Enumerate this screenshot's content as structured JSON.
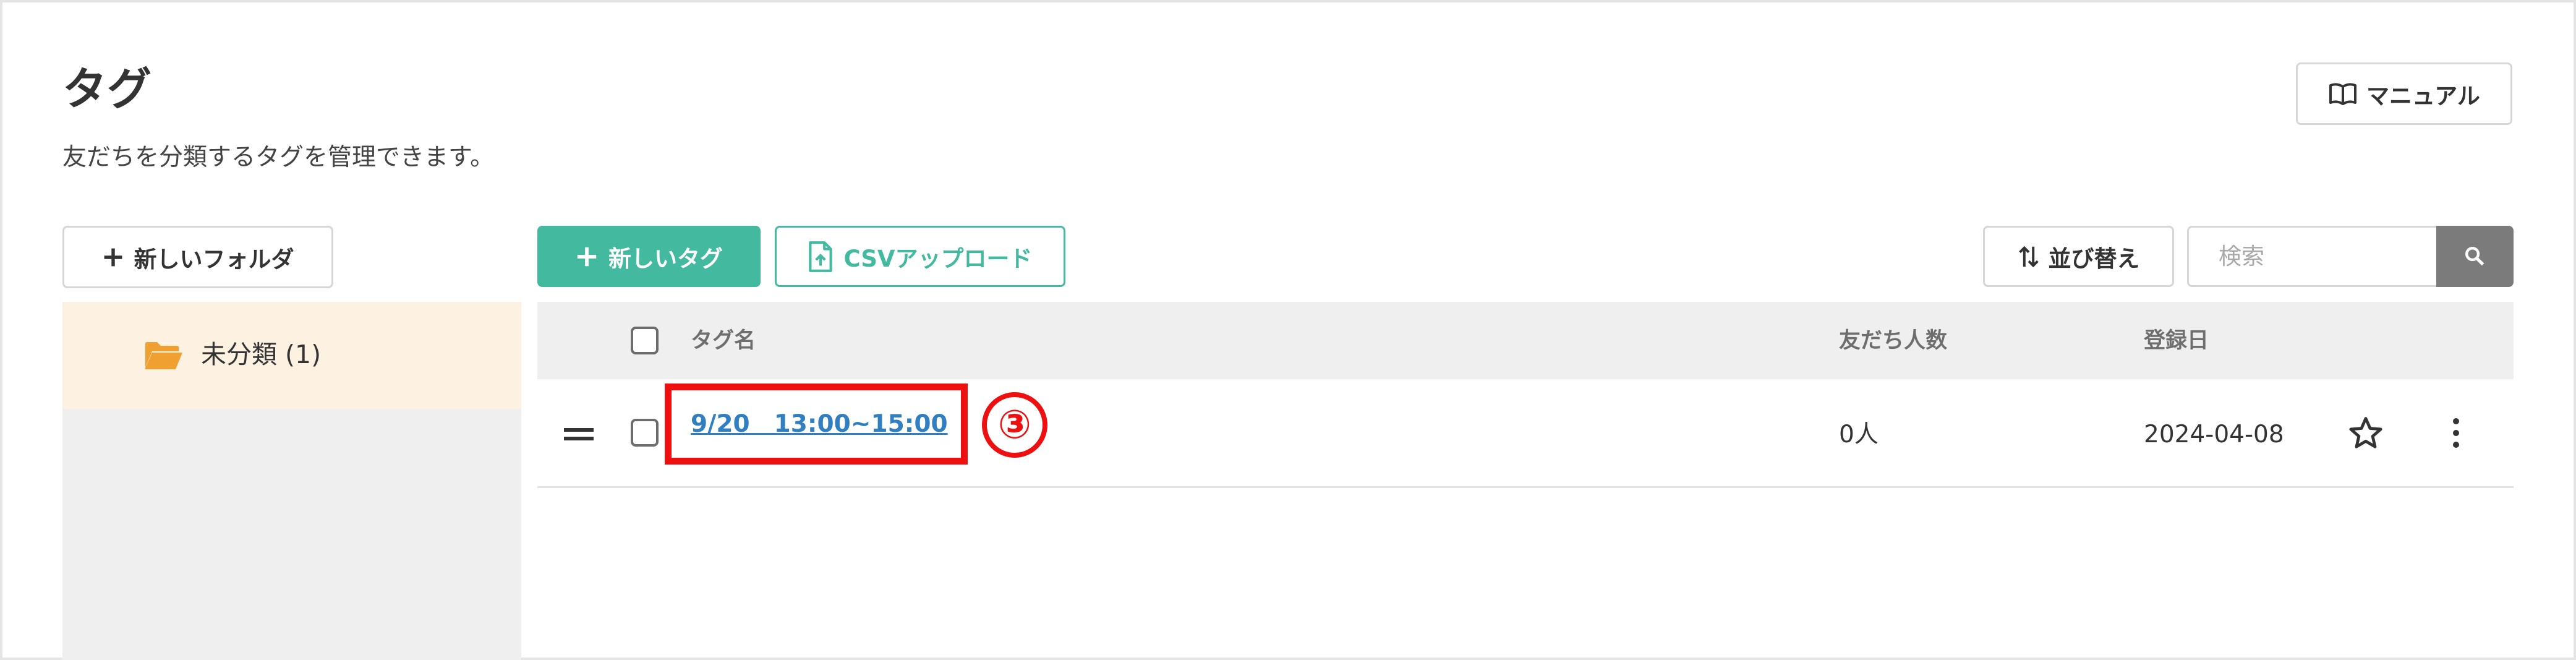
{
  "header": {
    "title": "タグ",
    "subtitle": "友だちを分類するタグを管理できます。",
    "manual_label": "マニュアル"
  },
  "sidebar": {
    "new_folder_label": "新しいフォルダ",
    "folders": [
      {
        "label": "未分類 (1)",
        "icon": "folder-open-icon",
        "selected": true
      }
    ]
  },
  "toolbar": {
    "new_tag_label": "新しいタグ",
    "csv_upload_label": "CSVアップロード",
    "sort_label": "並び替え",
    "search_placeholder": "検索"
  },
  "table": {
    "columns": {
      "tag_name": "タグ名",
      "friend_count": "友だち人数",
      "registered_date": "登録日"
    },
    "rows": [
      {
        "tag_name": "9/20　13:00~15:00",
        "friend_count": "0人",
        "registered_date": "2024-04-08"
      }
    ]
  },
  "annotation": {
    "callout": "③"
  },
  "colors": {
    "accent": "#43b9a0",
    "link": "#2f7fc1",
    "highlight": "#ee1010",
    "folder": "#f0a030",
    "selected_folder_bg": "#fdf2e1"
  }
}
